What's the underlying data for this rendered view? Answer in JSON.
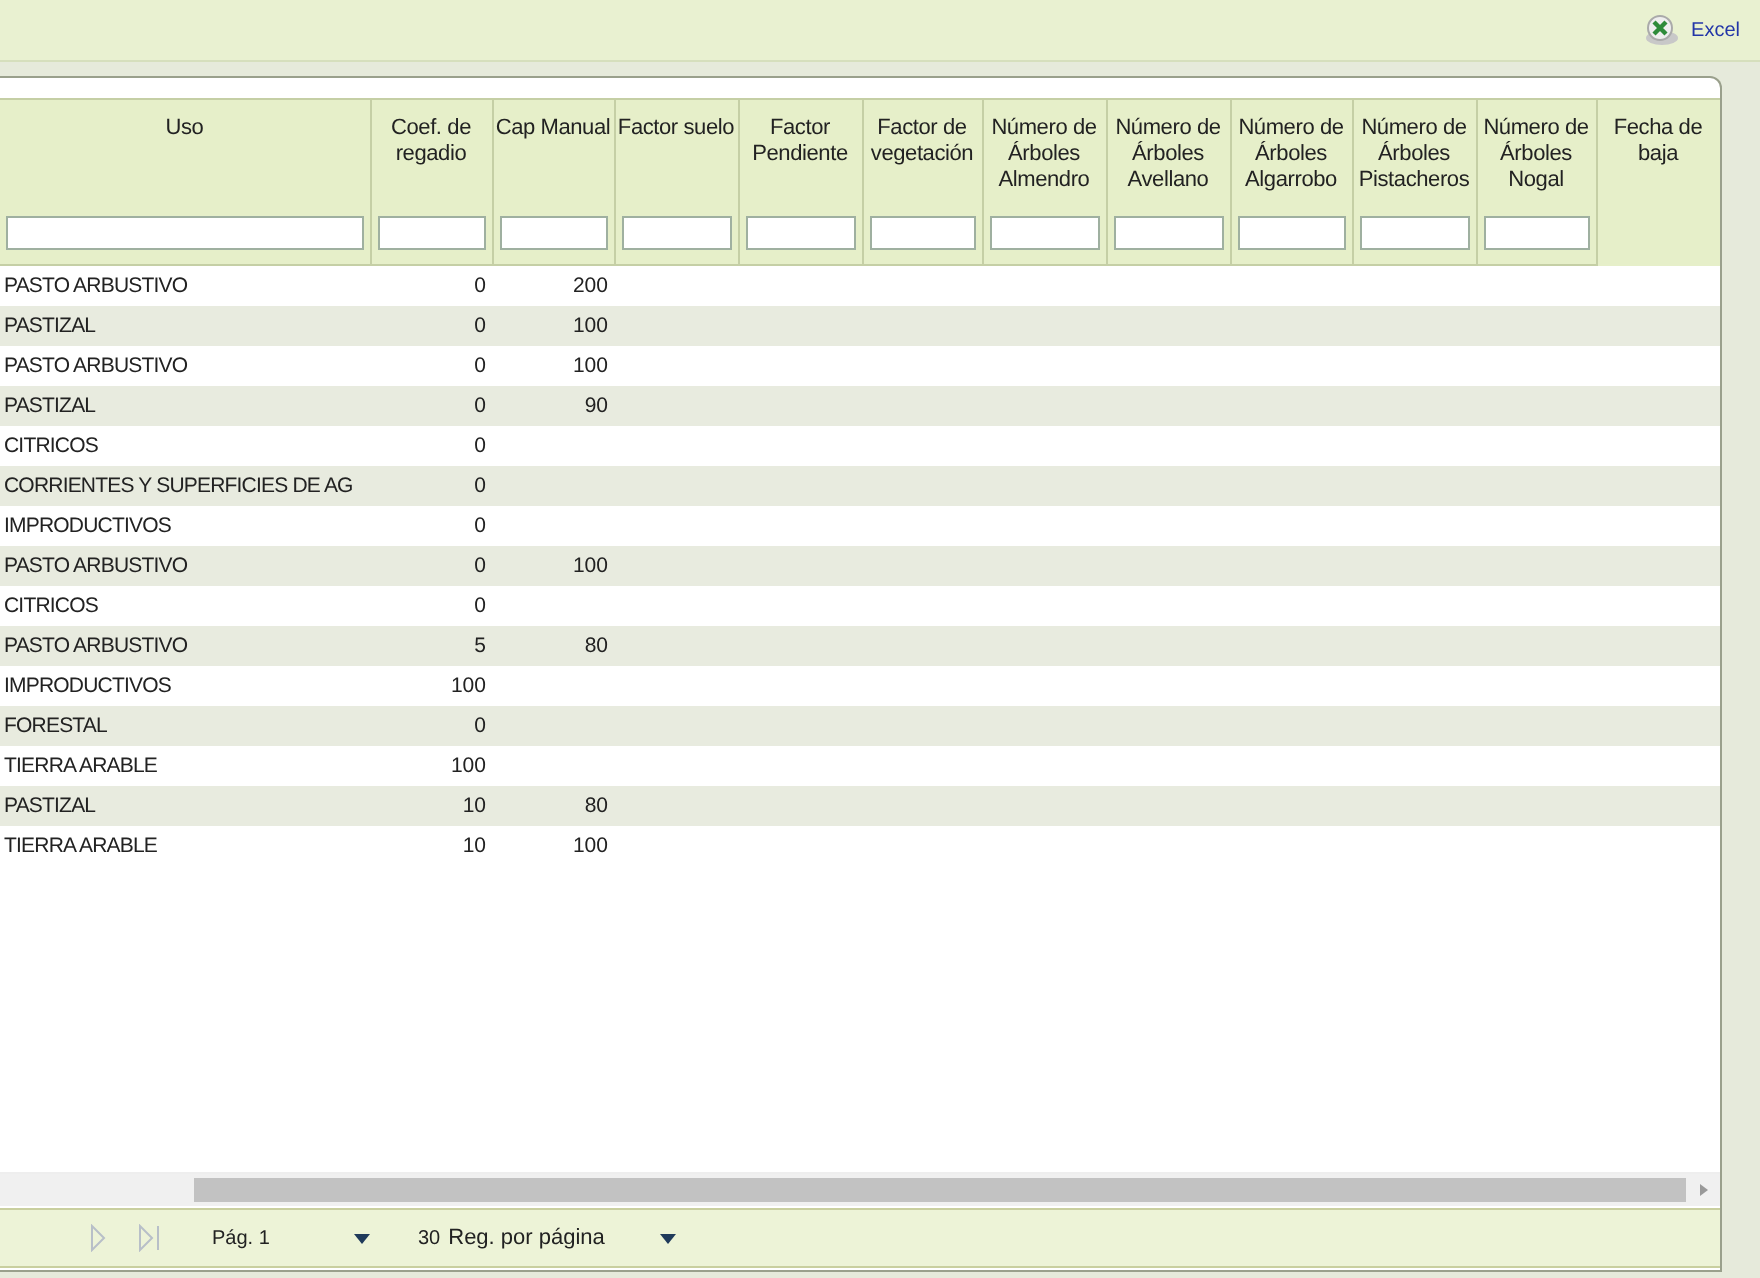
{
  "toolbar": {
    "export_label": "Excel"
  },
  "table": {
    "columns": [
      {
        "label": "Uso",
        "filter": true,
        "kind": "text"
      },
      {
        "label": "Coef. de regadio",
        "filter": true,
        "kind": "number"
      },
      {
        "label": "Cap Manual",
        "filter": true,
        "kind": "number"
      },
      {
        "label": "Factor suelo",
        "filter": true,
        "kind": "number"
      },
      {
        "label": "Factor Pendiente",
        "filter": true,
        "kind": "number"
      },
      {
        "label": "Factor de vegetación",
        "filter": true,
        "kind": "number"
      },
      {
        "label": "Número de Árboles Almendro",
        "filter": true,
        "kind": "number"
      },
      {
        "label": "Número de Árboles Avellano",
        "filter": true,
        "kind": "number"
      },
      {
        "label": "Número de Árboles Algarrobo",
        "filter": true,
        "kind": "number"
      },
      {
        "label": "Número de Árboles Pistacheros",
        "filter": true,
        "kind": "number"
      },
      {
        "label": "Número de Árboles Nogal",
        "filter": true,
        "kind": "number"
      },
      {
        "label": "Fecha de baja",
        "filter": false,
        "kind": "date"
      }
    ],
    "rows": [
      {
        "cells": [
          "PASTO ARBUSTIVO",
          "0",
          "200"
        ]
      },
      {
        "cells": [
          "PASTIZAL",
          "0",
          "100"
        ]
      },
      {
        "cells": [
          "PASTO ARBUSTIVO",
          "0",
          "100"
        ]
      },
      {
        "cells": [
          "PASTIZAL",
          "0",
          "90"
        ]
      },
      {
        "cells": [
          "CITRICOS",
          "0"
        ]
      },
      {
        "cells": [
          "CORRIENTES Y SUPERFICIES DE AG",
          "0"
        ]
      },
      {
        "cells": [
          "IMPRODUCTIVOS",
          "0"
        ]
      },
      {
        "cells": [
          "PASTO ARBUSTIVO",
          "0",
          "100"
        ]
      },
      {
        "cells": [
          "CITRICOS",
          "0"
        ]
      },
      {
        "cells": [
          "PASTO ARBUSTIVO",
          "5",
          "80"
        ]
      },
      {
        "cells": [
          "IMPRODUCTIVOS",
          "100"
        ]
      },
      {
        "cells": [
          "FORESTAL",
          "0"
        ]
      },
      {
        "cells": [
          "TIERRA ARABLE",
          "100"
        ]
      },
      {
        "cells": [
          "PASTIZAL",
          "10",
          "80"
        ]
      },
      {
        "cells": [
          "TIERRA ARABLE",
          "10",
          "100"
        ]
      }
    ]
  },
  "pager": {
    "next_disabled": true,
    "last_disabled": true,
    "page": "Pág. 1",
    "page_size": "30",
    "page_size_label": "Reg. por página"
  }
}
